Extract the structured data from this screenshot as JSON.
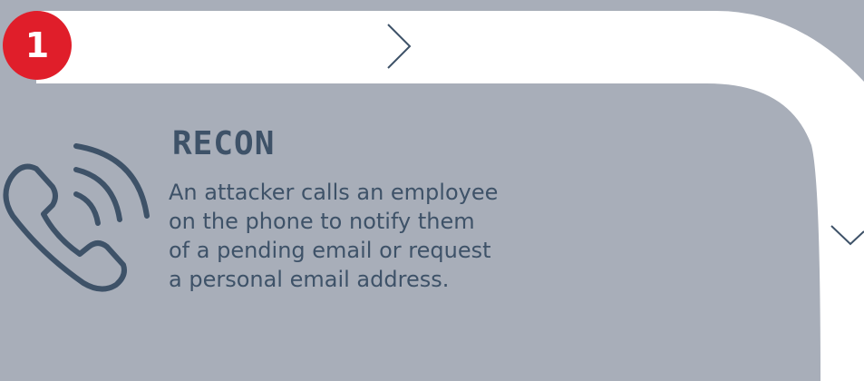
{
  "step": {
    "number": "1",
    "title": "RECON",
    "description_lines": [
      "An attacker calls an employee",
      "on the phone to notify them",
      "of a pending email or request",
      "a personal email address."
    ],
    "icon": "phone-ringing-icon"
  },
  "path": {
    "arrow_icons": [
      "chevron-right-icon",
      "chevron-down-icon"
    ]
  },
  "colors": {
    "background": "#a8aeb9",
    "path": "#ffffff",
    "badge": "#e01e2a",
    "text": "#3e5268"
  }
}
